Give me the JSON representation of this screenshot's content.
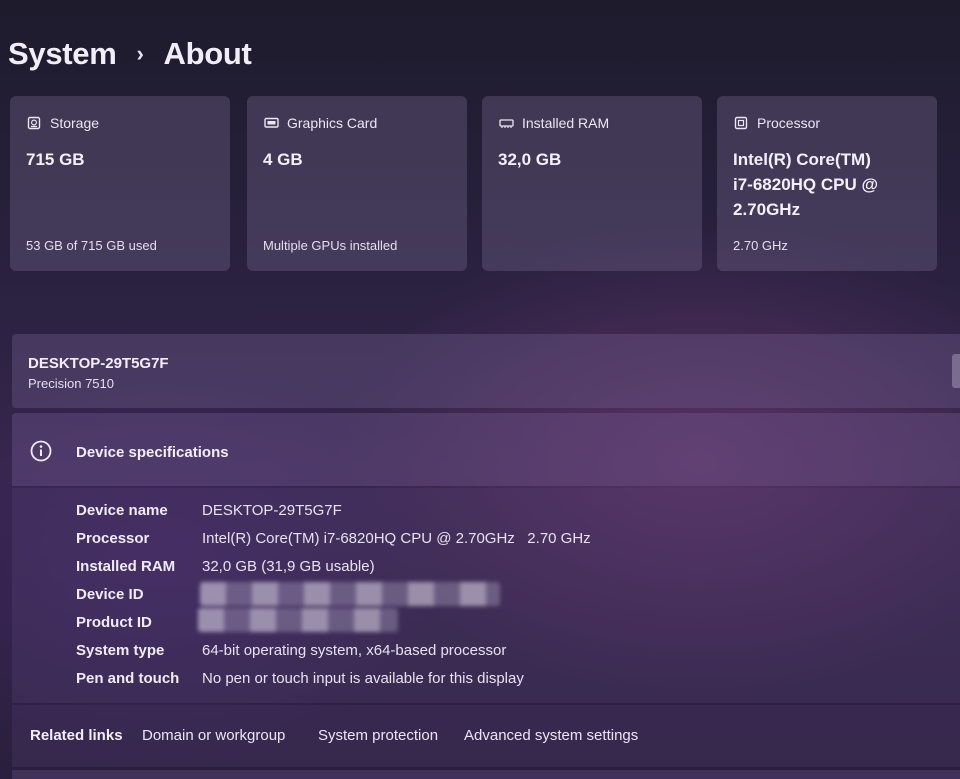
{
  "breadcrumb": {
    "parent": "System",
    "separator": "›",
    "current": "About"
  },
  "cards": [
    {
      "icon": "storage-icon",
      "label": "Storage",
      "value": "715 GB",
      "sub": "53 GB of 715 GB used"
    },
    {
      "icon": "graphics-card-icon",
      "label": "Graphics Card",
      "value": "4 GB",
      "sub": "Multiple GPUs installed"
    },
    {
      "icon": "ram-icon",
      "label": "Installed RAM",
      "value": "32,0 GB",
      "sub": ""
    },
    {
      "icon": "processor-icon",
      "label": "Processor",
      "value_lines": [
        "Intel(R) Core(TM)",
        "i7-6820HQ CPU @",
        "2.70GHz"
      ],
      "sub": "2.70 GHz"
    }
  ],
  "device": {
    "name": "DESKTOP-29T5G7F",
    "model": "Precision 7510"
  },
  "specs": {
    "icon": "info-icon",
    "title": "Device specifications",
    "rows": [
      {
        "key": "Device name",
        "value": "DESKTOP-29T5G7F"
      },
      {
        "key": "Processor",
        "value": "Intel(R) Core(TM) i7-6820HQ CPU @ 2.70GHz   2.70 GHz"
      },
      {
        "key": "Installed RAM",
        "value": "32,0 GB (31,9 GB usable)"
      },
      {
        "key": "Device ID",
        "value": ""
      },
      {
        "key": "Product ID",
        "value": ""
      },
      {
        "key": "System type",
        "value": "64-bit operating system, x64-based processor"
      },
      {
        "key": "Pen and touch",
        "value": "No pen or touch input is available for this display"
      }
    ]
  },
  "related": {
    "label": "Related links",
    "links": [
      "Domain or workgroup",
      "System protection",
      "Advanced system settings"
    ]
  }
}
